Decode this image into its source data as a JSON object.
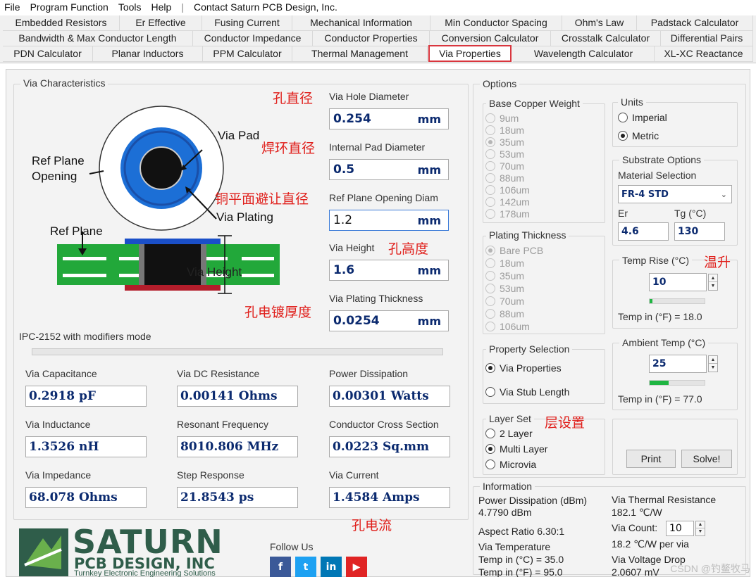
{
  "menu": {
    "items": [
      "File",
      "Program Function",
      "Tools",
      "Help"
    ],
    "separator": "|",
    "contact": "Contact Saturn PCB Design, Inc."
  },
  "tabs": {
    "row1": [
      "Embedded Resistors",
      "Er Effective",
      "Fusing Current",
      "Mechanical Information",
      "Min Conductor Spacing",
      "Ohm's Law",
      "Padstack Calculator"
    ],
    "row2": [
      "Bandwidth & Max Conductor Length",
      "Conductor Impedance",
      "Conductor Properties",
      "Conversion Calculator",
      "Crosstalk Calculator",
      "Differential Pairs"
    ],
    "row3": [
      "PDN Calculator",
      "Planar Inductors",
      "PPM Calculator",
      "Thermal Management",
      "Via Properties",
      "Wavelength Calculator",
      "XL-XC Reactance"
    ],
    "active": "Via Properties"
  },
  "via_characteristics": {
    "title": "Via Characteristics",
    "diagram": {
      "via_pad": "Via Pad",
      "ref_plane_opening": [
        "Ref Plane",
        "Opening"
      ],
      "via_plating": "Via Plating",
      "ref_plane": "Ref Plane",
      "via_height": "Via Height"
    },
    "mode_text": "IPC-2152 with modifiers mode",
    "inputs": [
      {
        "label": "Via Hole Diameter",
        "value": "0.254",
        "unit": "mm",
        "note": "孔直径"
      },
      {
        "label": "Internal Pad Diameter",
        "value": "0.5",
        "unit": "mm",
        "note": "焊环直径"
      },
      {
        "label": "Ref Plane Opening Diam",
        "value": "1.2",
        "unit": "mm",
        "note": "铜平面避让直径"
      },
      {
        "label": "Via Height",
        "value": "1.6",
        "unit": "mm",
        "note": "孔高度"
      },
      {
        "label": "Via Plating Thickness",
        "value": "0.0254",
        "unit": "mm",
        "note": "孔电镀厚度"
      }
    ],
    "results": [
      {
        "label": "Via Capacitance",
        "value": "0.2918 pF"
      },
      {
        "label": "Via DC Resistance",
        "value": "0.00141 Ohms"
      },
      {
        "label": "Power Dissipation",
        "value": "0.00301 Watts"
      },
      {
        "label": "Via Inductance",
        "value": "1.3526 nH"
      },
      {
        "label": "Resonant Frequency",
        "value": "8010.806 MHz"
      },
      {
        "label": "Conductor Cross Section",
        "value": "0.0223 Sq.mm"
      },
      {
        "label": "Via Impedance",
        "value": "68.078 Ohms"
      },
      {
        "label": "Step Response",
        "value": "21.8543 ps"
      },
      {
        "label": "Via Current",
        "value": "1.4584 Amps"
      }
    ],
    "current_note": "孔电流"
  },
  "options": {
    "title": "Options",
    "base_copper": {
      "title": "Base Copper Weight",
      "items": [
        "9um",
        "18um",
        "35um",
        "53um",
        "70um",
        "88um",
        "106um",
        "142um",
        "178um"
      ],
      "selected": "35um"
    },
    "plating": {
      "title": "Plating Thickness",
      "items": [
        "Bare PCB",
        "18um",
        "35um",
        "53um",
        "70um",
        "88um",
        "106um"
      ],
      "selected": "Bare PCB"
    },
    "property_selection": {
      "title": "Property Selection",
      "items": [
        "Via Properties",
        "Via Stub Length"
      ],
      "selected": "Via Properties"
    },
    "layer_set": {
      "title": "Layer Set",
      "note": "层设置",
      "items": [
        "2 Layer",
        "Multi Layer",
        "Microvia"
      ],
      "selected": "Multi Layer"
    },
    "units": {
      "title": "Units",
      "items": [
        "Imperial",
        "Metric"
      ],
      "selected": "Metric"
    },
    "substrate": {
      "title": "Substrate Options",
      "material_label": "Material Selection",
      "material_value": "FR-4 STD",
      "er_label": "Er",
      "er_value": "4.6",
      "tg_label": "Tg (°C)",
      "tg_value": "130"
    },
    "temp_rise": {
      "title": "Temp Rise (°C)",
      "note": "温升",
      "value": "10",
      "fahrenheit": "Temp in (°F) = 18.0",
      "level": 0.05
    },
    "ambient": {
      "title": "Ambient Temp (°C)",
      "value": "25",
      "fahrenheit": "Temp in (°F) = 77.0",
      "level": 0.35
    },
    "buttons": {
      "print": "Print",
      "solve": "Solve!"
    }
  },
  "information": {
    "title": "Information",
    "power_label": "Power Dissipation (dBm)",
    "power_value": "4.7790 dBm",
    "aspect": "Aspect Ratio  6.30:1",
    "via_temp_label": "Via Temperature",
    "temp_c": "Temp in (°C) = 35.0",
    "temp_f": "Temp in (°F) = 95.0",
    "thermal_label": "Via Thermal Resistance",
    "thermal_value": "182.1 ℃/W",
    "count_label": "Via Count:",
    "count_value": "10",
    "per_via": "18.2 ℃/W per via",
    "drop_label": "Via Voltage Drop",
    "drop_value": "2.0607 mV"
  },
  "footer": {
    "logo_big": "SATURN",
    "logo_sub": "PCB DESIGN, INC",
    "logo_tag": "Turnkey Electronic Engineering Solutions",
    "follow": "Follow Us",
    "social_icons": [
      "facebook-icon",
      "twitter-icon",
      "linkedin-icon",
      "youtube-icon"
    ],
    "social_glyphs": [
      "f",
      "t",
      "in",
      "▶"
    ]
  },
  "watermark": "CSDN @钓鳌牧马",
  "colors": {
    "accent_red": "#e0201c",
    "value_blue": "#0b2a6f",
    "pcb_green": "#22a83a",
    "via_blue": "#1c6fd6",
    "progress_green": "#1fb542"
  }
}
